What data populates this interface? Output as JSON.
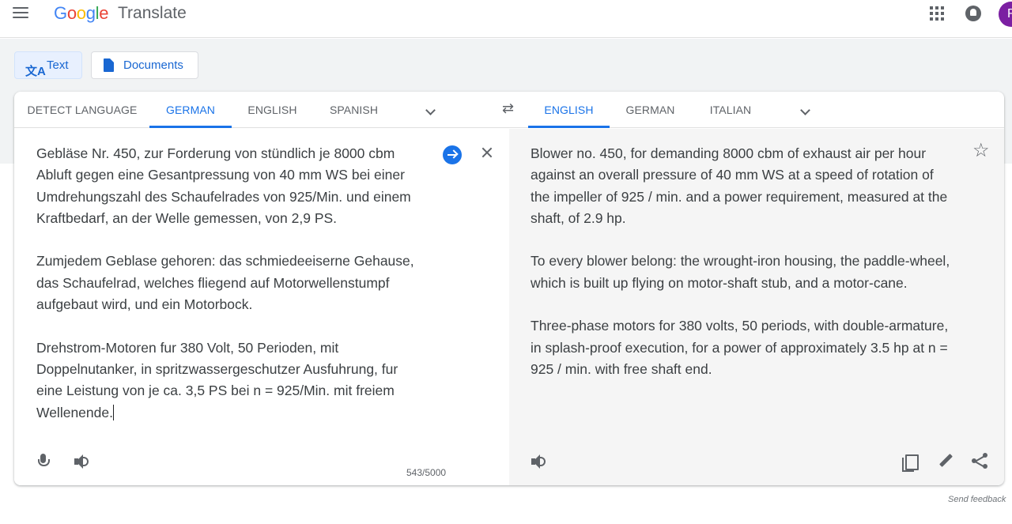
{
  "header": {
    "logo_letters": [
      "G",
      "o",
      "o",
      "g",
      "l",
      "e"
    ],
    "product": "Translate",
    "avatar_initial": "R"
  },
  "modes": {
    "text_label": "Text",
    "documents_label": "Documents"
  },
  "source_languages": {
    "detect": "DETECT LANGUAGE",
    "german": "GERMAN",
    "english": "ENGLISH",
    "spanish": "SPANISH",
    "active": "GERMAN"
  },
  "target_languages": {
    "english": "ENGLISH",
    "german": "GERMAN",
    "italian": "ITALIAN",
    "active": "ENGLISH"
  },
  "source": {
    "text": "Gebläse Nr. 450, zur Forderung von stündlich je 8000 cbm\nAbluft gegen eine Gesantpressung von 40 mm WS bei einer\nUmdrehungszahl des Schaufelrades von 925/Min. und einem\nKraftbedarf, an der Welle gemessen, von 2,9 PS.\n\nZumjedem Geblase gehoren: das schmiedeeiserne Gehause,\ndas Schaufelrad, welches fliegend auf Motorwellenstumpf\naufgebaut wird, und ein Motorbock.\n\nDrehstrom-Motoren fur 380 Volt, 50 Perioden, mit\nDoppelnutanker, in spritzwassergeschutzer Ausfuhrung, fur\neine Leistung von je ca. 3,5 PS bei n = 925/Min. mit freiem\nWellenende.",
    "char_count": "543/5000"
  },
  "target": {
    "text": "Blower no. 450, for demanding 8000 cbm of exhaust air per hour\nagainst an overall pressure of 40 mm WS at a speed of rotation of\nthe impeller of 925 / min. and a power requirement, measured at the\nshaft, of 2.9 hp.\n\nTo every blower belong: the wrought-iron housing, the paddle-wheel,\nwhich is built up flying on motor-shaft stub, and a motor-cane.\n\nThree-phase motors for 380 volts, 50 periods, with double-armature,\nin splash-proof execution, for a power of approximately 3.5 hp at n =\n925 / min. with free shaft end."
  },
  "footer": {
    "feedback": "Send feedback"
  },
  "colors": {
    "accent": "#1a73e8",
    "avatar": "#7b1fa2",
    "target_bg": "#f5f5f5"
  }
}
